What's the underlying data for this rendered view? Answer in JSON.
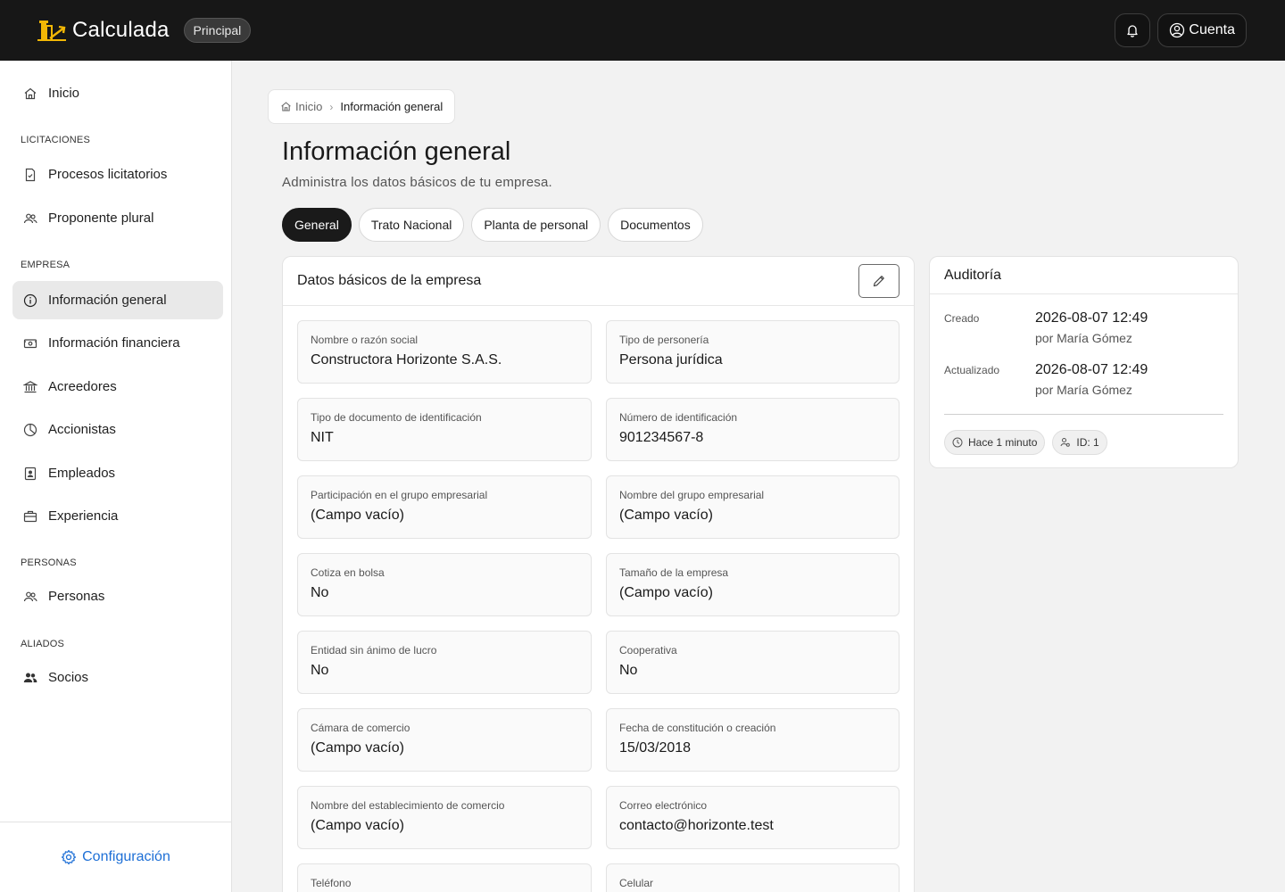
{
  "app": {
    "name": "Calculada",
    "environment": "Principal",
    "account_label": "Cuenta"
  },
  "sidebar": {
    "items": [
      {
        "label": "Inicio",
        "icon": "home-icon"
      },
      {
        "label": "Procesos licitatorios",
        "icon": "document-check-icon"
      },
      {
        "label": "Proponente plural",
        "icon": "users-icon"
      },
      {
        "label": "Información general",
        "icon": "info-icon",
        "active": true
      },
      {
        "label": "Información financiera",
        "icon": "money-icon"
      },
      {
        "label": "Acreedores",
        "icon": "bank-icon"
      },
      {
        "label": "Accionistas",
        "icon": "pie-chart-icon"
      },
      {
        "label": "Empleados",
        "icon": "id-badge-icon"
      },
      {
        "label": "Experiencia",
        "icon": "briefcase-icon"
      },
      {
        "label": "Personas",
        "icon": "users-icon"
      },
      {
        "label": "Socios",
        "icon": "users-filled-icon"
      }
    ],
    "sections": {
      "licitaciones": "LICITACIONES",
      "empresa": "EMPRESA",
      "personas": "PERSONAS",
      "aliados": "ALIADOS"
    },
    "footer_label": "Configuración"
  },
  "breadcrumb": {
    "home": "Inicio",
    "current": "Información general"
  },
  "page": {
    "title": "Información general",
    "subtitle": "Administra los datos básicos de tu empresa."
  },
  "tabs": [
    {
      "label": "General",
      "active": true
    },
    {
      "label": "Trato Nacional"
    },
    {
      "label": "Planta de personal"
    },
    {
      "label": "Documentos"
    }
  ],
  "card": {
    "title": "Datos básicos de la empresa",
    "fields": [
      {
        "label": "Nombre o razón social",
        "value": "Constructora Horizonte S.A.S."
      },
      {
        "label": "Tipo de personería",
        "value": "Persona jurídica"
      },
      {
        "label": "Tipo de documento de identificación",
        "value": "NIT"
      },
      {
        "label": "Número de identificación",
        "value": "901234567-8"
      },
      {
        "label": "Participación en el grupo empresarial",
        "value": "(Campo vacío)"
      },
      {
        "label": "Nombre del grupo empresarial",
        "value": "(Campo vacío)"
      },
      {
        "label": "Cotiza en bolsa",
        "value": "No"
      },
      {
        "label": "Tamaño de la empresa",
        "value": "(Campo vacío)"
      },
      {
        "label": "Entidad sin ánimo de lucro",
        "value": "No"
      },
      {
        "label": "Cooperativa",
        "value": "No"
      },
      {
        "label": "Cámara de comercio",
        "value": "(Campo vacío)"
      },
      {
        "label": "Fecha de constitución o creación",
        "value": "15/03/2018"
      },
      {
        "label": "Nombre del establecimiento de comercio",
        "value": "(Campo vacío)"
      },
      {
        "label": "Correo electrónico",
        "value": "contacto@horizonte.test"
      },
      {
        "label": "Teléfono",
        "value": ""
      },
      {
        "label": "Celular",
        "value": ""
      }
    ]
  },
  "audit": {
    "title": "Auditoría",
    "created_label": "Creado",
    "created_date": "2026-08-07 12:49",
    "created_by": "por María Gómez",
    "updated_label": "Actualizado",
    "updated_date": "2026-08-07 12:49",
    "updated_by": "por María Gómez",
    "relative_time": "Hace 1 minuto",
    "id_label": "ID: 1"
  },
  "colors": {
    "topbar": "#171717",
    "accent_link": "#1d6fd6",
    "logo": "#f2b705"
  }
}
